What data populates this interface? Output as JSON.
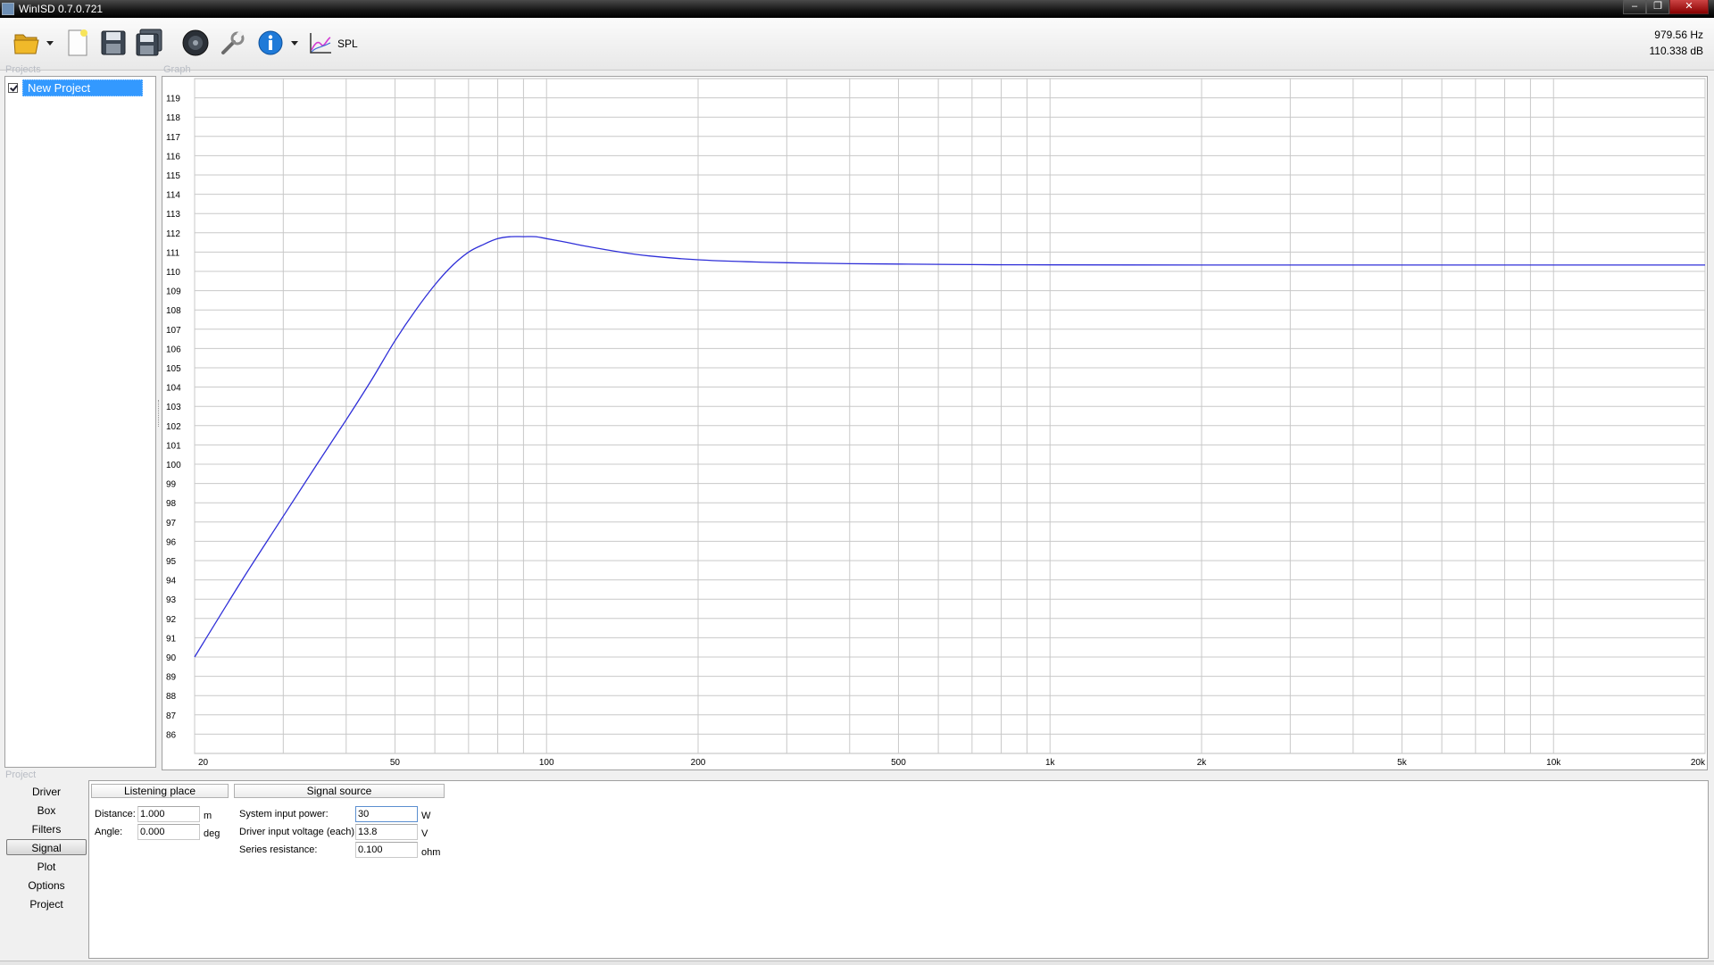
{
  "window": {
    "title": "WinISD 0.7.0.721"
  },
  "toolbar": {
    "spl_label": "SPL"
  },
  "readout": {
    "frequency": "979.56 Hz",
    "level": "110.338 dB"
  },
  "sections": {
    "projects": "Projects",
    "graph": "Graph",
    "project": "Project"
  },
  "projects": {
    "items": [
      {
        "label": "New Project",
        "checked": true
      }
    ]
  },
  "nav": {
    "items": [
      "Driver",
      "Box",
      "Filters",
      "Signal",
      "Plot",
      "Options",
      "Project"
    ],
    "active": "Signal"
  },
  "tabs": {
    "listening": "Listening place",
    "source": "Signal source"
  },
  "listening": {
    "distance_label": "Distance:",
    "distance_value": "1.000",
    "distance_unit": "m",
    "angle_label": "Angle:",
    "angle_value": "0.000",
    "angle_unit": "deg"
  },
  "source": {
    "power_label": "System input power:",
    "power_value": "30",
    "power_unit": "W",
    "voltage_label": "Driver input voltage (each):",
    "voltage_value": "13.8",
    "voltage_unit": "V",
    "resistance_label": "Series resistance:",
    "resistance_value": "0.100",
    "resistance_unit": "ohm"
  },
  "colors": {
    "curve": "#2f2fd8",
    "grid": "#c8c8c8",
    "selection": "#3399ff"
  },
  "chart_data": {
    "type": "line",
    "title": "",
    "xlabel": "",
    "ylabel": "",
    "xscale": "log",
    "xlim": [
      20,
      20000
    ],
    "ylim": [
      85,
      120
    ],
    "grid": true,
    "x_tick_labels": [
      {
        "v": 20,
        "label": "20"
      },
      {
        "v": 50,
        "label": "50"
      },
      {
        "v": 100,
        "label": "100"
      },
      {
        "v": 200,
        "label": "200"
      },
      {
        "v": 500,
        "label": "500"
      },
      {
        "v": 1000,
        "label": "1k"
      },
      {
        "v": 2000,
        "label": "2k"
      },
      {
        "v": 5000,
        "label": "5k"
      },
      {
        "v": 10000,
        "label": "10k"
      },
      {
        "v": 20000,
        "label": "20k"
      }
    ],
    "y_ticks": [
      86,
      87,
      88,
      89,
      90,
      91,
      92,
      93,
      94,
      95,
      96,
      97,
      98,
      99,
      100,
      101,
      102,
      103,
      104,
      105,
      106,
      107,
      108,
      109,
      110,
      111,
      112,
      113,
      114,
      115,
      116,
      117,
      118,
      119
    ],
    "series": [
      {
        "x": [
          20,
          25,
          30,
          35,
          40,
          45,
          50,
          55,
          60,
          65,
          70,
          75,
          80,
          85,
          90,
          95,
          100,
          110,
          120,
          140,
          160,
          200,
          250,
          300,
          400,
          500,
          700,
          1000,
          2000,
          5000,
          10000,
          20000
        ],
        "y": [
          90.0,
          94.1,
          97.3,
          100.0,
          102.3,
          104.4,
          106.4,
          108.0,
          109.3,
          110.3,
          111.0,
          111.4,
          111.7,
          111.8,
          111.8,
          111.8,
          111.7,
          111.5,
          111.3,
          111.0,
          110.8,
          110.6,
          110.5,
          110.45,
          110.4,
          110.38,
          110.35,
          110.34,
          110.33,
          110.33,
          110.33,
          110.33
        ]
      }
    ]
  }
}
